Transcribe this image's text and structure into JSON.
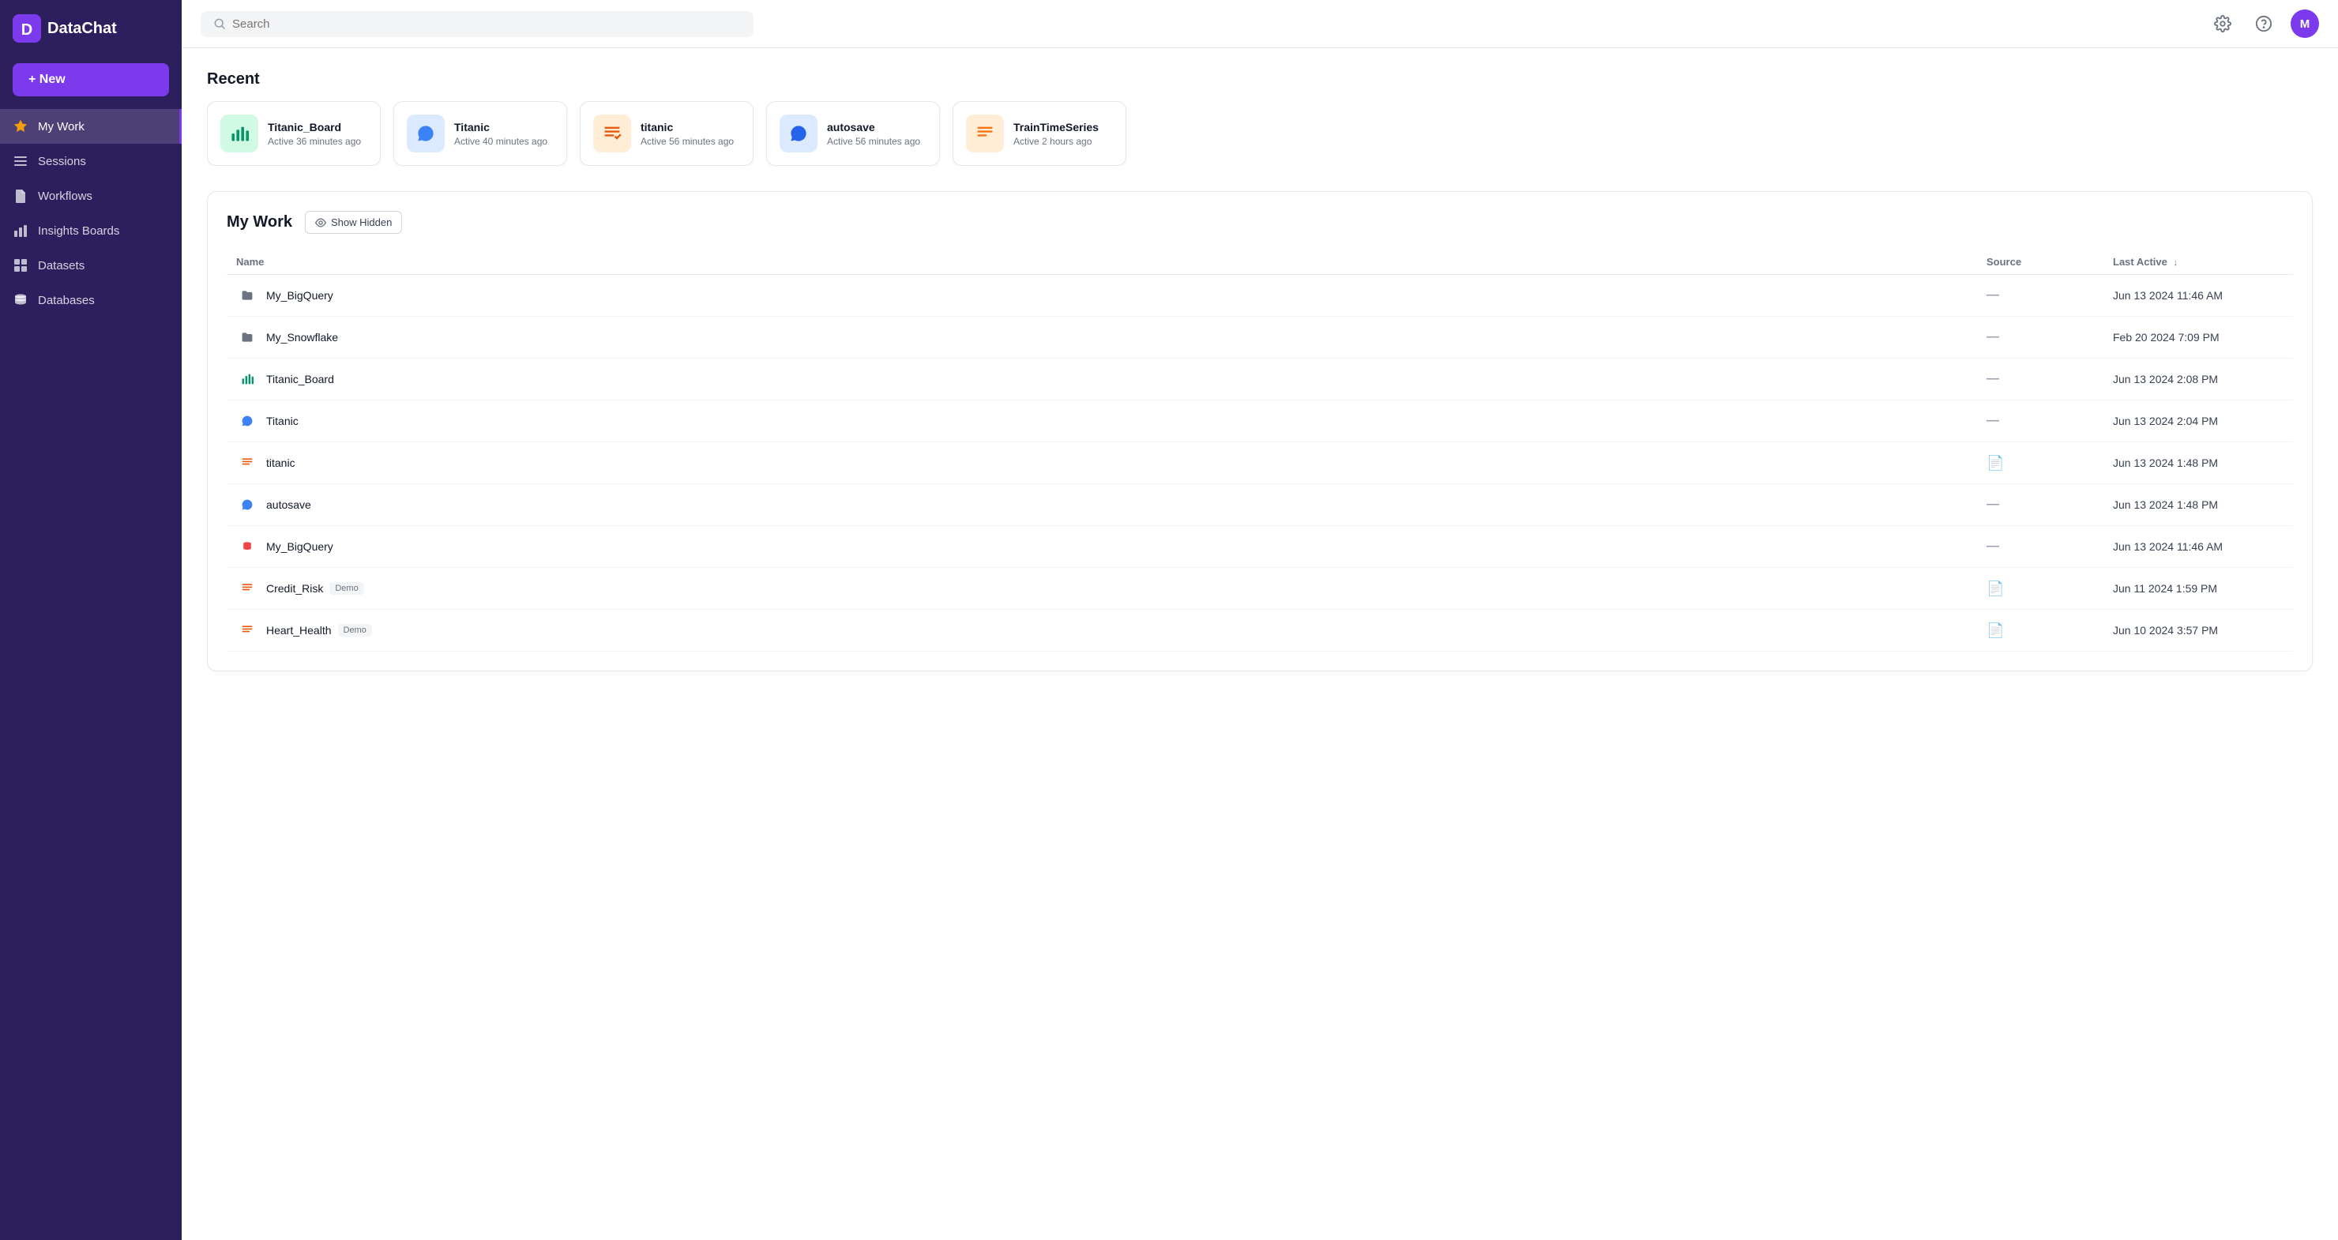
{
  "app": {
    "name": "DataChat",
    "logo_letter": "D"
  },
  "sidebar": {
    "new_button_label": "+ New",
    "items": [
      {
        "id": "my-work",
        "label": "My Work",
        "icon": "star",
        "active": true
      },
      {
        "id": "sessions",
        "label": "Sessions",
        "icon": "list"
      },
      {
        "id": "workflows",
        "label": "Workflows",
        "icon": "file"
      },
      {
        "id": "insights-boards",
        "label": "Insights Boards",
        "icon": "bar-chart"
      },
      {
        "id": "datasets",
        "label": "Datasets",
        "icon": "grid"
      },
      {
        "id": "databases",
        "label": "Databases",
        "icon": "database"
      }
    ]
  },
  "header": {
    "search_placeholder": "Search",
    "settings_label": "Settings",
    "help_label": "Help",
    "user_initial": "M"
  },
  "recent": {
    "title": "Recent",
    "cards": [
      {
        "name": "Titanic_Board",
        "time": "Active 36 minutes ago",
        "icon_type": "bar-chart",
        "color": "green"
      },
      {
        "name": "Titanic",
        "time": "Active 40 minutes ago",
        "icon_type": "chat",
        "color": "blue-light"
      },
      {
        "name": "titanic",
        "time": "Active 56 minutes ago",
        "icon_type": "dataset",
        "color": "orange"
      },
      {
        "name": "autosave",
        "time": "Active 56 minutes ago",
        "icon_type": "chat",
        "color": "blue"
      },
      {
        "name": "TrainTimeSeries",
        "time": "Active 2 hours ago",
        "icon_type": "dataset",
        "color": "orange2"
      }
    ]
  },
  "mywork": {
    "title": "My Work",
    "show_hidden_label": "Show Hidden",
    "columns": {
      "name": "Name",
      "source": "Source",
      "last_active": "Last Active"
    },
    "rows": [
      {
        "name": "My_BigQuery",
        "type": "folder",
        "source": "—",
        "last_active": "Jun 13 2024 11:46 AM",
        "demo": false
      },
      {
        "name": "My_Snowflake",
        "type": "folder",
        "source": "—",
        "last_active": "Feb 20 2024 7:09 PM",
        "demo": false
      },
      {
        "name": "Titanic_Board",
        "type": "bar-chart",
        "source": "—",
        "last_active": "Jun 13 2024 2:08 PM",
        "demo": false
      },
      {
        "name": "Titanic",
        "type": "chat",
        "source": "—",
        "last_active": "Jun 13 2024 2:04 PM",
        "demo": false
      },
      {
        "name": "titanic",
        "type": "dataset",
        "source": "file",
        "last_active": "Jun 13 2024 1:48 PM",
        "demo": false
      },
      {
        "name": "autosave",
        "type": "chat",
        "source": "—",
        "last_active": "Jun 13 2024 1:48 PM",
        "demo": false
      },
      {
        "name": "My_BigQuery",
        "type": "database",
        "source": "—",
        "last_active": "Jun 13 2024 11:46 AM",
        "demo": false
      },
      {
        "name": "Credit_Risk",
        "type": "dataset",
        "source": "file",
        "last_active": "Jun 11 2024 1:59 PM",
        "demo": true
      },
      {
        "name": "Heart_Health",
        "type": "dataset",
        "source": "file",
        "last_active": "Jun 10 2024 3:57 PM",
        "demo": true
      }
    ]
  }
}
